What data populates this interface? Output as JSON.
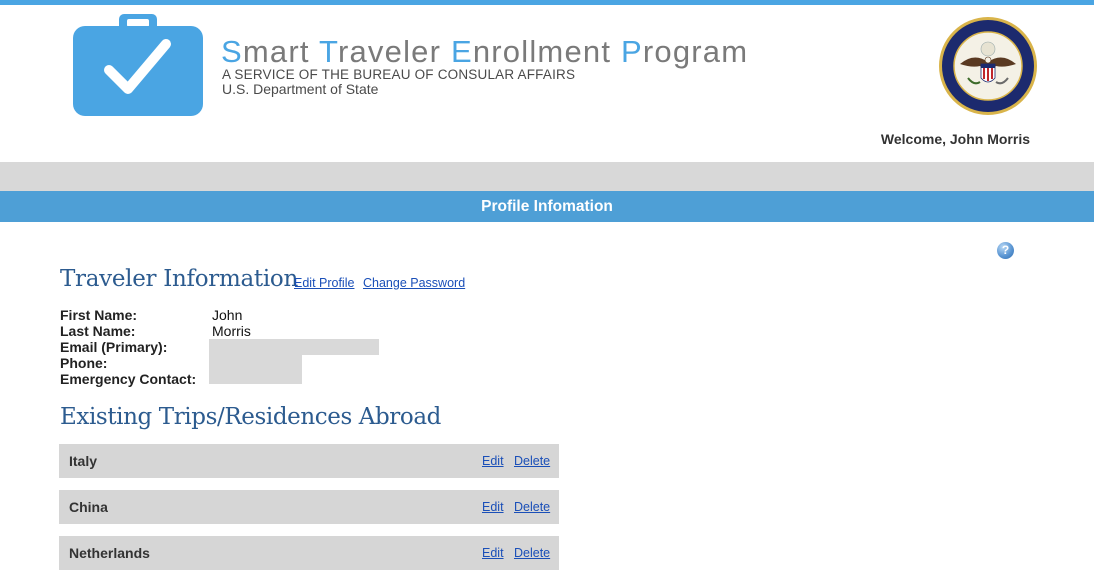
{
  "brand": {
    "title_parts": [
      {
        "cap": "S",
        "rest": "mart"
      },
      {
        "cap": "T",
        "rest": "raveler"
      },
      {
        "cap": "E",
        "rest": "nrollment"
      },
      {
        "cap": "P",
        "rest": "rogram"
      }
    ],
    "subtitle": "A SERVICE OF THE BUREAU OF CONSULAR AFFAIRS",
    "department": "U.S. Department of State",
    "logo_icon": "briefcase-check-icon",
    "seal_icon": "department-of-state-seal-icon"
  },
  "header": {
    "welcome": "Welcome, John Morris"
  },
  "banner": {
    "title": "Profile Infomation"
  },
  "traveler": {
    "title": "Traveler Information",
    "edit_profile": "Edit Profile",
    "change_password": "Change Password",
    "fields": [
      {
        "label": "First Name:",
        "value": "John"
      },
      {
        "label": "Last Name:",
        "value": "Morris"
      },
      {
        "label": "Email (Primary):",
        "value": ""
      },
      {
        "label": "Phone:",
        "value": ""
      },
      {
        "label": "Emergency Contact:",
        "value": ""
      }
    ]
  },
  "trips": {
    "title": "Existing Trips/Residences Abroad",
    "items": [
      {
        "name": "Italy",
        "edit": "Edit",
        "delete": "Delete"
      },
      {
        "name": "China",
        "edit": "Edit",
        "delete": "Delete"
      },
      {
        "name": "Netherlands",
        "edit": "Edit",
        "delete": "Delete"
      }
    ]
  },
  "help": {
    "icon": "help-icon",
    "label": "?"
  },
  "colors": {
    "accent": "#4aa5e3",
    "banner": "#4e9fd6",
    "heading": "#2c5b8f",
    "link": "#1a4fb8"
  }
}
